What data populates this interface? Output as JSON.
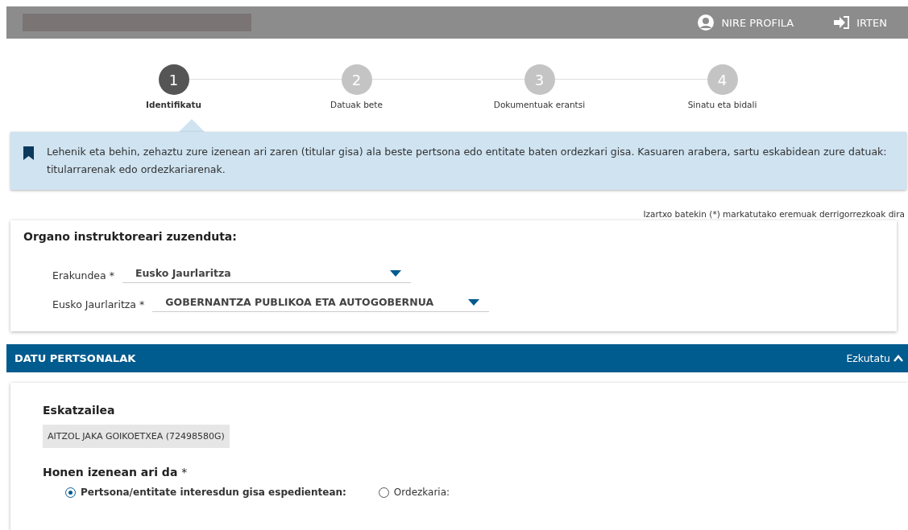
{
  "header": {
    "links": [
      {
        "kind": "profile",
        "label": "NIRE PROFILA"
      },
      {
        "kind": "logout",
        "label": "IRTEN"
      }
    ]
  },
  "steps": [
    {
      "number": "1",
      "label": "Identifikatu",
      "selected": true
    },
    {
      "number": "2",
      "label": "Datuak bete",
      "selected": false
    },
    {
      "number": "3",
      "label": "Dokumentuak erantsi",
      "selected": false
    },
    {
      "number": "4",
      "label": "Sinatu eta bidali",
      "selected": false
    }
  ],
  "info": "Lehenik eta behin, zehaztu zure izenean ari zaren (titular gisa) ala beste pertsona edo entitate baten ordezkari gisa. Kasuaren arabera, sartu eskabidean zure datuak: titularrarenak edo ordezkariarenak.",
  "required_note": "Izartxo batekin (*) markatutako eremuak derrigorrezkoak dira",
  "organ": {
    "title": "Organo instruktoreari zuzenduta:",
    "fields": [
      {
        "label": "Erakundea",
        "required": "*",
        "value": "Eusko Jaurlaritza"
      },
      {
        "label": "Eusko Jaurlaritza",
        "required": "*",
        "value": "GOBERNANTZA PUBLIKOA ETA AUTOGOBERNUA"
      }
    ]
  },
  "section": {
    "title": "DATU PERTSONALAK",
    "toggle": "Ezkutatu",
    "expanded": true
  },
  "applicant": {
    "label": "Eskatzailea",
    "value": "AITZOL JAKA GOIKOETXEA (72498580G)"
  },
  "acting": {
    "label": "Honen izenean ari da",
    "required": "*",
    "options": [
      {
        "label": "Pertsona/entitate interesdun gisa espedientean:",
        "selected": true
      },
      {
        "label": "Ordezkaria:",
        "selected": false
      }
    ]
  }
}
